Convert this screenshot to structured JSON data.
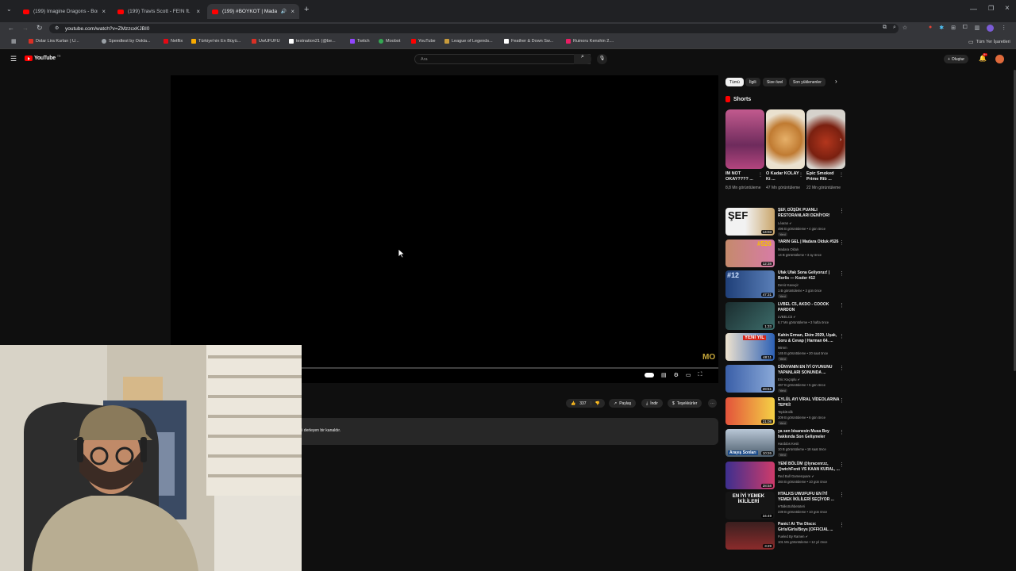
{
  "browser": {
    "tabs": [
      {
        "title": "(199) Imagine Dragons - Bone"
      },
      {
        "title": "(199) Travis Scott - FE!N ft. Play"
      },
      {
        "title": "(199) #BOYKOT | Madara O"
      }
    ],
    "url": "youtube.com/watch?v=ZMzzcxKJBI0",
    "bookmarks": [
      {
        "label": "Dolar Lira Kurları | U...",
        "color": "#d93025"
      },
      {
        "label": "Speedtest by Ookla...",
        "color": "#9aa0a6"
      },
      {
        "label": "Netflix",
        "color": "#e50914"
      },
      {
        "label": "Türkiye'nin En Büyü...",
        "color": "#f9ab00"
      },
      {
        "label": "UwUFUFU",
        "color": "#d93025"
      },
      {
        "label": "testnation21 (@be...",
        "color": "#ffffff"
      },
      {
        "label": "Twitch",
        "color": "#9146ff"
      },
      {
        "label": "Moobot",
        "color": "#34a853"
      },
      {
        "label": "YouTube",
        "color": "#ff0000"
      },
      {
        "label": "League of Legends...",
        "color": "#c89b3c"
      },
      {
        "label": "Feather & Down Sw...",
        "color": "#ffffff"
      },
      {
        "label": "Ruinoru Kenshin 2....",
        "color": "#e91e63"
      }
    ],
    "all_bookmarks": "Tüm Yer İşaretleri"
  },
  "youtube": {
    "logo": "YouTube",
    "country": "TR",
    "search_placeholder": "Ara",
    "create": "Oluştur",
    "notification_count": "9+"
  },
  "player": {
    "watermark": "MO"
  },
  "actions": {
    "likes": "337",
    "share": "Paylaş",
    "download": "İndir",
    "thanks": "Teşekkürler"
  },
  "description": "...içeriklerini derleyen bir kanaldır.",
  "filters": [
    "Tümü",
    "İlgili",
    "Size özel",
    "Son yüklenenler"
  ],
  "shorts": {
    "title": "Shorts",
    "items": [
      {
        "title": "IM NOT OKAY???? ...",
        "views": "8,8 Mn görüntüleme"
      },
      {
        "title": "O Kadar KOLAY Ki ...",
        "views": "47 Mn görüntüleme"
      },
      {
        "title": "Epic Smoked Prime Rib ...",
        "views": "22 Mn görüntüleme"
      }
    ]
  },
  "recommendations": [
    {
      "title": "ŞEF, DÜŞÜK PUANLI RESTORANLARI DENİYOR!",
      "channel": "Léaran ✔",
      "views": "496 B görüntüleme • 4 gün önce",
      "duration": "14:03",
      "new": "Yeni"
    },
    {
      "title": "YARIN GEL | Madara Olduk #526",
      "channel": "Madara Olduk",
      "views": "14 B görüntüleme • 3 ay önce",
      "duration": "12:38",
      "new": ""
    },
    {
      "title": "Ufak Ufak Sona Geliyoruz! | Borlis — Kısıler #12",
      "channel": "Deniz Kavuçir",
      "views": "1 B görüntüleme • 3 gün önce",
      "duration": "47:31",
      "new": "Yeni"
    },
    {
      "title": "LVBEL C5, AKDO - COOOK PARDON",
      "channel": "LVBELC5 ✔",
      "views": "8,7 Mn görüntüleme • 3 hafta önce",
      "duration": "1:33",
      "new": ""
    },
    {
      "title": "Kahin Erman, Ekim 2029, Uşak, Soru & Cevap | Harman 64. ...",
      "channel": "Mirnm",
      "views": "145 B görüntüleme • 20 saat önce",
      "duration": "48:11",
      "new": "Yeni"
    },
    {
      "title": "DÜNYANIN EN İYİ OYUNUNU YAPANLARI SONUNDA ...",
      "channel": "Eric Kaçoplu ✔",
      "views": "467 B görüntüleme • 5 gün önce",
      "duration": "28:51",
      "new": "Yeni"
    },
    {
      "title": "EYLÜL AYI VİRAL VİDEOLARINA TEPKİ!",
      "channel": "TepkiKolik",
      "views": "309 B görüntüleme • 6 gün önce",
      "duration": "21:08",
      "new": "Yeni"
    },
    {
      "title": "ya sen bisanesin Musa Bey hakkında Son Gelişmeler",
      "channel": "Harddos Kesit",
      "views": "10 B görüntüleme • 18 saat önce",
      "duration": "10:26",
      "new": "Yeni"
    },
    {
      "title": "YENİ BÖLÜM @lyracenrzz, @wtchFenit VS KAAN KURAL, ...",
      "channel": "Red Bull Gamesquare ✔",
      "views": "384 B görüntüleme • 10 gün önce",
      "duration": "28:58",
      "new": ""
    },
    {
      "title": "HTALKS UWUFUFU EN İYİ YEMEK İKİLİLERİ SEÇİYOR ...",
      "channel": "HTalksSohbetoteri",
      "views": "239 B görüntüleme • 10 gün önce",
      "duration": "34:49",
      "new": ""
    },
    {
      "title": "Panic! At The Disco: Girls/Girls/Boys [OFFICIAL ...",
      "channel": "Fueled By Ramen ✔",
      "views": "101 Mn görüntüleme • 12 yıl önce",
      "duration": "3:29",
      "new": ""
    }
  ],
  "recommendation_thumb_texts": [
    "ŞEF",
    "#526",
    "#12",
    "",
    "YENİ YIL",
    "",
    "",
    "Arayış Sonları",
    "",
    "EN İYİ YEMEK İKİLİLERİ",
    ""
  ]
}
